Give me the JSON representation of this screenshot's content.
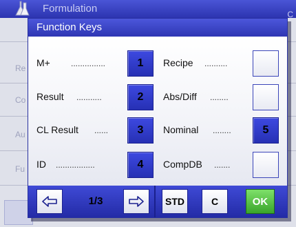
{
  "background": {
    "title": "Formulation",
    "title_right": "C",
    "row_labels": [
      "Re",
      "Co",
      "Au",
      "Fu"
    ]
  },
  "dialog": {
    "title": "Function Keys"
  },
  "left_keys": [
    {
      "label": "M+",
      "dots": "...............",
      "number": "1"
    },
    {
      "label": "Result",
      "dots": "...........",
      "number": "2"
    },
    {
      "label": "CL Result",
      "dots": "......",
      "number": "3"
    },
    {
      "label": "ID",
      "dots": ".................",
      "number": "4"
    }
  ],
  "right_keys": [
    {
      "label": "Recipe",
      "dots": "..........",
      "number": ""
    },
    {
      "label": "Abs/Diff",
      "dots": "........",
      "number": ""
    },
    {
      "label": "Nominal",
      "dots": "........",
      "number": "5"
    },
    {
      "label": "CompDB",
      "dots": ".......",
      "number": ""
    }
  ],
  "footer": {
    "page": "1/3",
    "std_label": "STD",
    "c_label": "C",
    "ok_label": "OK"
  },
  "colors": {
    "header_blue": "#3a44c8",
    "key_blue": "#2f3ac8",
    "ok_green": "#4cbb37"
  }
}
